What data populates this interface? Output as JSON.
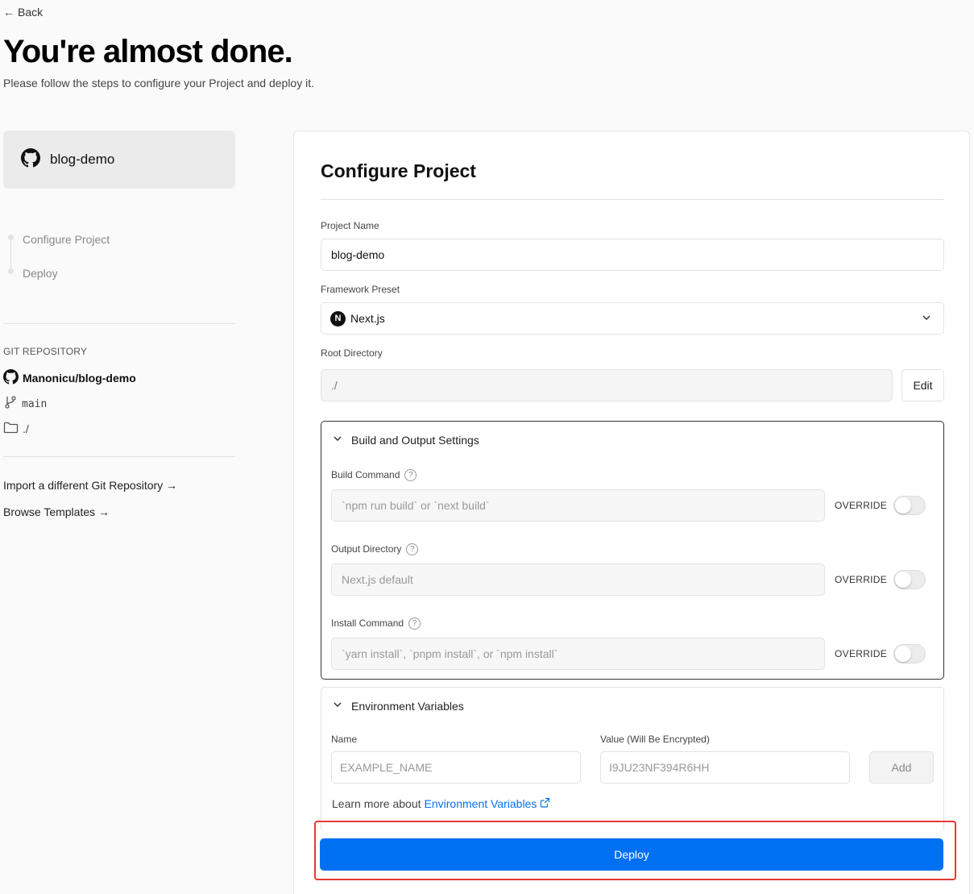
{
  "header": {
    "back_label": "Back",
    "title": "You're almost done.",
    "subtitle": "Please follow the steps to configure your Project and deploy it."
  },
  "sidebar": {
    "repo_card_name": "blog-demo",
    "steps": [
      {
        "label": "Configure Project"
      },
      {
        "label": "Deploy"
      }
    ],
    "git_heading": "GIT REPOSITORY",
    "repo_full_name": "Manonicu/blog-demo",
    "branch": "main",
    "directory": "./",
    "links": [
      {
        "label": "Import a different Git Repository →"
      },
      {
        "label": "Browse Templates →"
      }
    ]
  },
  "configure": {
    "title": "Configure Project",
    "project_name_label": "Project Name",
    "project_name_value": "blog-demo",
    "framework_label": "Framework Preset",
    "framework_value": "Next.js",
    "framework_icon_letter": "N",
    "root_dir_label": "Root Directory",
    "root_dir_value": "./",
    "edit_label": "Edit"
  },
  "build_settings": {
    "title": "Build and Output Settings",
    "override_label": "OVERRIDE",
    "rows": [
      {
        "label": "Build Command",
        "placeholder": "`npm run build` or `next build`",
        "override": false
      },
      {
        "label": "Output Directory",
        "placeholder": "Next.js default",
        "override": false
      },
      {
        "label": "Install Command",
        "placeholder": "`yarn install`, `pnpm install`, or `npm install`",
        "override": false
      }
    ]
  },
  "env_vars": {
    "title": "Environment Variables",
    "name_label": "Name",
    "value_label": "Value (Will Be Encrypted)",
    "name_placeholder": "EXAMPLE_NAME",
    "value_placeholder": "I9JU23NF394R6HH",
    "add_label": "Add",
    "learn_more_prefix": "Learn more about",
    "learn_more_link": "Environment Variables"
  },
  "deploy": {
    "label": "Deploy",
    "color": "#0070f3",
    "highlight_color": "#e53935"
  }
}
